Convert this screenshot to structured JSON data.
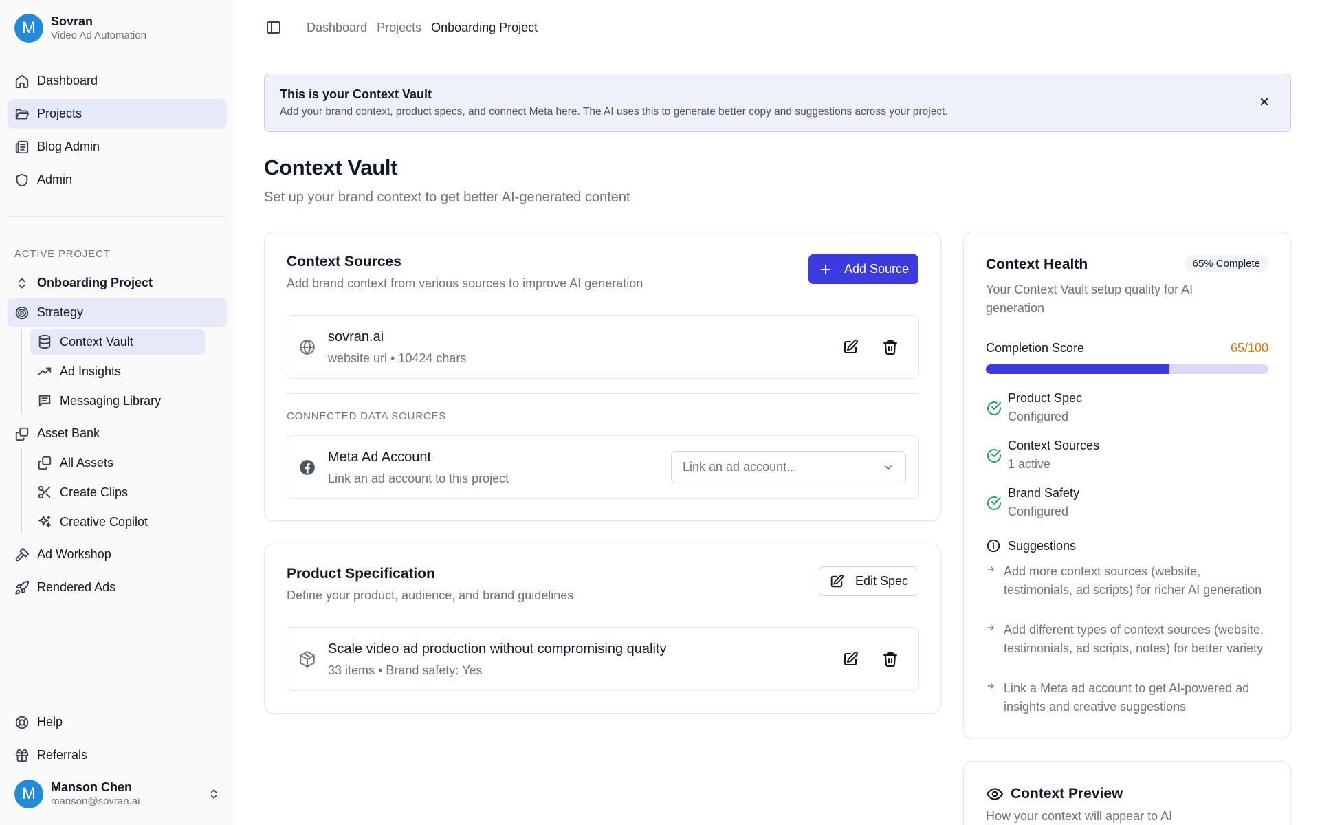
{
  "brand": {
    "initial": "M",
    "name": "Sovran",
    "tagline": "Video Ad Automation"
  },
  "nav": [
    {
      "label": "Dashboard",
      "icon": "home-icon"
    },
    {
      "label": "Projects",
      "icon": "folder-icon",
      "active": true
    },
    {
      "label": "Blog Admin",
      "icon": "newspaper-icon"
    },
    {
      "label": "Admin",
      "icon": "shield-icon"
    }
  ],
  "active_project": {
    "section_label": "ACTIVE PROJECT",
    "project_name": "Onboarding Project",
    "strategy": "Strategy",
    "strategy_items": [
      "Context Vault",
      "Ad Insights",
      "Messaging Library"
    ],
    "asset_bank": "Asset Bank",
    "asset_items": [
      "All Assets",
      "Create Clips",
      "Creative Copilot"
    ],
    "ad_workshop": "Ad Workshop",
    "rendered_ads": "Rendered Ads"
  },
  "footer_nav": {
    "help": "Help",
    "referrals": "Referrals"
  },
  "user": {
    "initial": "M",
    "name": "Manson Chen",
    "email": "manson@sovran.ai"
  },
  "breadcrumb": [
    "Dashboard",
    "Projects",
    "Onboarding Project"
  ],
  "banner": {
    "title": "This is your Context Vault",
    "text": "Add your brand context, product specs, and connect Meta here. The AI uses this to generate better copy and suggestions across your project."
  },
  "page": {
    "title": "Context Vault",
    "subtitle": "Set up your brand context to get better AI-generated content"
  },
  "context_sources": {
    "title": "Context Sources",
    "subtitle": "Add brand context from various sources to improve AI generation",
    "add_button": "Add Source",
    "source": {
      "name": "sovran.ai",
      "meta": "website url • 10424 chars"
    },
    "connected_label": "CONNECTED DATA SOURCES",
    "meta_account": {
      "name": "Meta Ad Account",
      "desc": "Link an ad account to this project",
      "select_placeholder": "Link an ad account..."
    }
  },
  "product_spec": {
    "title": "Product Specification",
    "subtitle": "Define your product, audience, and brand guidelines",
    "edit_button": "Edit Spec",
    "item": {
      "name": "Scale video ad production without compromising quality",
      "meta": "33 items • Brand safety: Yes"
    }
  },
  "health": {
    "title": "Context Health",
    "badge": "65% Complete",
    "subtitle": "Your Context Vault setup quality for AI generation",
    "score_label": "Completion Score",
    "score_value": "65/100",
    "score_fraction": 0.65,
    "checks": [
      {
        "title": "Product Spec",
        "status": "Configured"
      },
      {
        "title": "Context Sources",
        "status": "1 active"
      },
      {
        "title": "Brand Safety",
        "status": "Configured"
      }
    ],
    "suggestions_title": "Suggestions",
    "suggestions": [
      "Add more context sources (website, testimonials, ad scripts) for richer AI generation",
      "Add different types of context sources (website, testimonials, ad scripts, notes) for better variety",
      "Link a Meta ad account to get AI-powered ad insights and creative suggestions"
    ]
  },
  "preview": {
    "title": "Context Preview",
    "subtitle": "How your context will appear to AI"
  },
  "colors": {
    "accent": "#3b3be0",
    "success": "#22a06b",
    "warning": "#d97706",
    "active_bg": "#e6e9f8"
  }
}
